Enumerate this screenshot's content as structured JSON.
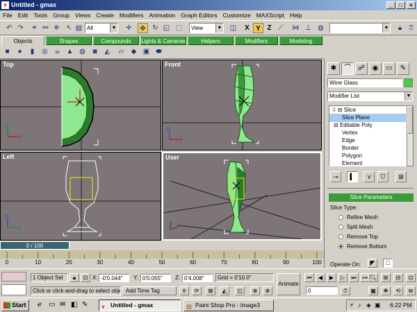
{
  "window": {
    "title": "Untitled - gmax"
  },
  "menu": [
    "File",
    "Edit",
    "Tools",
    "Group",
    "Views",
    "Create",
    "Modifiers",
    "Animation",
    "Graph Editors",
    "Customize",
    "MAXScript",
    "Help"
  ],
  "toolbar": {
    "selection_filter": "All",
    "reference_coord": "View",
    "axis_x": "X",
    "axis_y": "Y",
    "axis_z": "Z"
  },
  "tabs": [
    "Objects",
    "Shapes",
    "Compounds",
    "Lights & Cameras",
    "Helpers",
    "Modifiers",
    "Modeling"
  ],
  "viewports": {
    "top": "Top",
    "front": "Front",
    "left": "Left",
    "user": "User"
  },
  "time_slider": {
    "label": "0 / 100",
    "current": 0,
    "total": 100
  },
  "trackbar_ticks": [
    "0",
    "10",
    "20",
    "30",
    "40",
    "50",
    "60",
    "70",
    "80",
    "90",
    "100"
  ],
  "command_panel": {
    "object_name": "Wine Glass",
    "modifier_list": "Modifier List",
    "stack": [
      {
        "label": "Slice",
        "indent": 1,
        "prefix": "⊟"
      },
      {
        "label": "Slice Plane",
        "indent": 3,
        "prefix": "",
        "selected": true
      },
      {
        "label": "Editable Poly",
        "indent": 1,
        "prefix": "⊟"
      },
      {
        "label": "Vertex",
        "indent": 3,
        "prefix": ""
      },
      {
        "label": "Edge",
        "indent": 3,
        "prefix": ""
      },
      {
        "label": "Border",
        "indent": 3,
        "prefix": ""
      },
      {
        "label": "Polygon",
        "indent": 3,
        "prefix": ""
      },
      {
        "label": "Element",
        "indent": 3,
        "prefix": ""
      }
    ],
    "rollout_title": "Slice Parameters",
    "slice_type_label": "Slice Type:",
    "slice_types": [
      {
        "label": "Refine Mesh",
        "checked": false
      },
      {
        "label": "Split Mesh",
        "checked": false
      },
      {
        "label": "Remove Top",
        "checked": false
      },
      {
        "label": "Remove Bottom",
        "checked": true
      }
    ],
    "operate_on_label": "Operate On:"
  },
  "status": {
    "selection": "1 Object Sel",
    "prompt": "Click or click-and-drag to select obje",
    "x_label": "X:",
    "x_value": "-0'0.044\"",
    "y_label": "Y:",
    "y_value": "0'0.055\"",
    "z_label": "Z:",
    "z_value": "0'4.008\"",
    "grid": "Grid = 0'10.0\"",
    "add_time_tag": "Add Time Tag",
    "animate": "Animate",
    "frame": "0"
  },
  "taskbar": {
    "start": "Start",
    "tasks": [
      {
        "label": "Untitled - gmax",
        "active": true
      },
      {
        "label": "Paint Shop Pro - Image3",
        "active": false
      }
    ],
    "clock": "6:22 PM"
  }
}
